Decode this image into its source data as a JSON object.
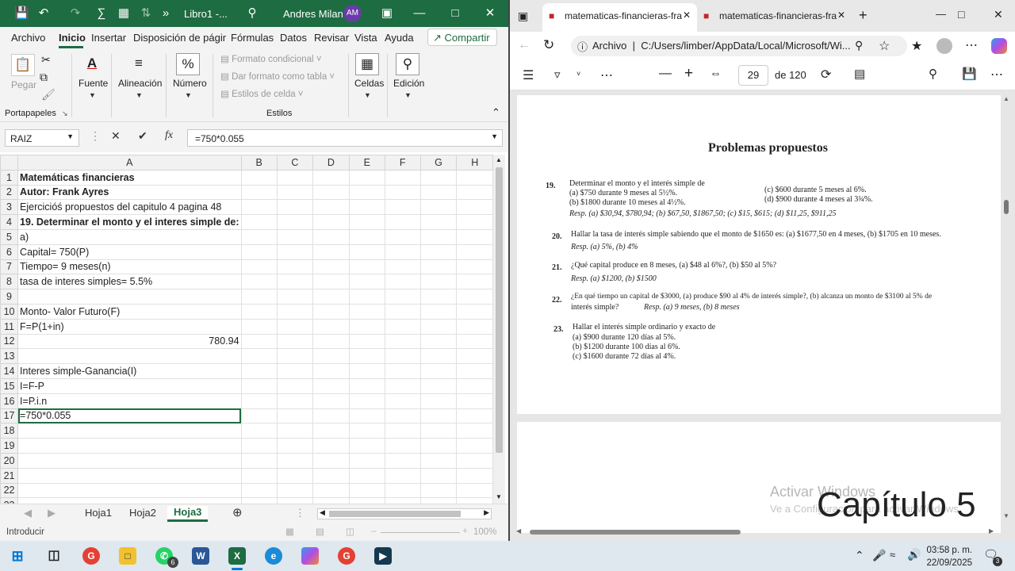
{
  "excel": {
    "title": "Libro1 -...",
    "user_name": "Andres Milan",
    "user_initials": "AM",
    "menu": [
      "Archivo",
      "Inicio",
      "Insertar",
      "Disposición de págir",
      "Fórmulas",
      "Datos",
      "Revisar",
      "Vista",
      "Ayuda"
    ],
    "share_label": "Compartir",
    "ribbon": {
      "paste": "Pegar",
      "clipboard_group": "Portapapeles",
      "font": "Fuente",
      "alignment": "Alineación",
      "number": "Número",
      "cond_format": "Formato condicional",
      "table_format": "Dar formato como tabla",
      "cell_styles": "Estilos de celda",
      "styles_group": "Estilos",
      "cells": "Celdas",
      "editing": "Edición"
    },
    "name_box": "RAIZ",
    "formula": "=750*0.055",
    "columns": [
      "A",
      "B",
      "C",
      "D",
      "E",
      "F",
      "G",
      "H"
    ],
    "rows": [
      {
        "n": "1",
        "a": "Matemáticas financieras",
        "bold": true
      },
      {
        "n": "2",
        "a": "Autor: Frank Ayres",
        "bold": true
      },
      {
        "n": "3",
        "a": "Ejercicióś propuestos del capitulo 4 pagina 48",
        "bold": false
      },
      {
        "n": "4",
        "a": "19. Determinar el monto y el interes simple de:",
        "bold": true
      },
      {
        "n": "5",
        "a": "a)",
        "bold": false
      },
      {
        "n": "6",
        "a": "Capital= 750(P)",
        "bold": false
      },
      {
        "n": "7",
        "a": "Tiempo= 9 meses(n)",
        "bold": false
      },
      {
        "n": "8",
        "a": "tasa de interes simples= 5.5%",
        "bold": false
      },
      {
        "n": "9",
        "a": "",
        "bold": false
      },
      {
        "n": "10",
        "a": "Monto- Valor Futuro(F)",
        "bold": false
      },
      {
        "n": "11",
        "a": "F=P(1+in)",
        "bold": false
      },
      {
        "n": "12",
        "a": "780.94",
        "bold": false,
        "num": true
      },
      {
        "n": "13",
        "a": "",
        "bold": false
      },
      {
        "n": "14",
        "a": "Interes simple-Ganancia(I)",
        "bold": false
      },
      {
        "n": "15",
        "a": "I=F-P",
        "bold": false
      },
      {
        "n": "16",
        "a": "I=P.i.n",
        "bold": false
      },
      {
        "n": "17",
        "a": "=750*0.055",
        "bold": false,
        "selected": true
      },
      {
        "n": "18",
        "a": "",
        "bold": false
      },
      {
        "n": "19",
        "a": "",
        "bold": false
      },
      {
        "n": "20",
        "a": "",
        "bold": false
      },
      {
        "n": "21",
        "a": "",
        "bold": false
      },
      {
        "n": "22",
        "a": "",
        "bold": false
      },
      {
        "n": "23",
        "a": "",
        "bold": false
      }
    ],
    "sheets": [
      "Hoja1",
      "Hoja2",
      "Hoja3"
    ],
    "status_mode": "Introducir",
    "zoom": "100%",
    "accent": "#1e6c41"
  },
  "edge": {
    "tabs": [
      "matematicas-financieras-fra",
      "matematicas-financieras-fra"
    ],
    "address_prefix": "Archivo",
    "address": "C:/Users/limber/AppData/Local/Microsoft/Wi...",
    "page_number": "29",
    "page_total": "de 120"
  },
  "pdf": {
    "heading": "Problemas propuestos",
    "p19_num": "19.",
    "p19_text": "Determinar el monto y el interés simple de",
    "p19_a": "(a)   $750 durante 9 meses al 5½%.",
    "p19_c": "(c)   $600 durante 5 meses al 6%.",
    "p19_b": "(b)   $1800 durante 10 meses al 4½%.",
    "p19_d": "(d)   $900 durante 4 meses al 3¾%.",
    "p19_resp": "Resp.   (a) $30,94, $780,94;  (b) $67,50, $1867,50;  (c) $15, $615;  (d) $11,25, $911,25",
    "p20_num": "20.",
    "p20_text": "Hallar la tasa de interés simple sabiendo que el monto de $1650 es: (a) $1677,50 en 4 meses,  (b) $1705 en 10 meses.",
    "p20_resp": "Resp.   (a) 5%, (b) 4%",
    "p21_num": "21.",
    "p21_text": "¿Qué capital produce en 8 meses, (a) $48 al 6%?,  (b) $50 al 5%?",
    "p21_resp": "Resp.   (a) $1200, (b) $1500",
    "p22_num": "22.",
    "p22_text": "¿En qué tiempo un capital de $3000, (a) produce $90 al 4% de interés simple?, (b) alcanza un monto de $3100 al 5% de",
    "p22_text2": "interés simple?",
    "p22_resp": "Resp.   (a) 9 meses,  (b) 8 meses",
    "p23_num": "23.",
    "p23_text": "Hallar el interés simple ordinario y exacto de",
    "p23_a": "(a)   $900 durante 120 días al 5%.",
    "p23_b": "(b)   $1200 durante 100 días al 6%.",
    "p23_c": "(c)   $1600 durante 72 días al 4%."
  },
  "overlay": {
    "watermark_line1": "Activar Windows",
    "watermark_line2": "Ve a Configuración para activar Windows.",
    "chapter": "Capítulo 5"
  },
  "taskbar": {
    "time": "03:58 p. m.",
    "date": "22/09/2025",
    "whatsapp_badge": "6",
    "notif_count": "3"
  }
}
